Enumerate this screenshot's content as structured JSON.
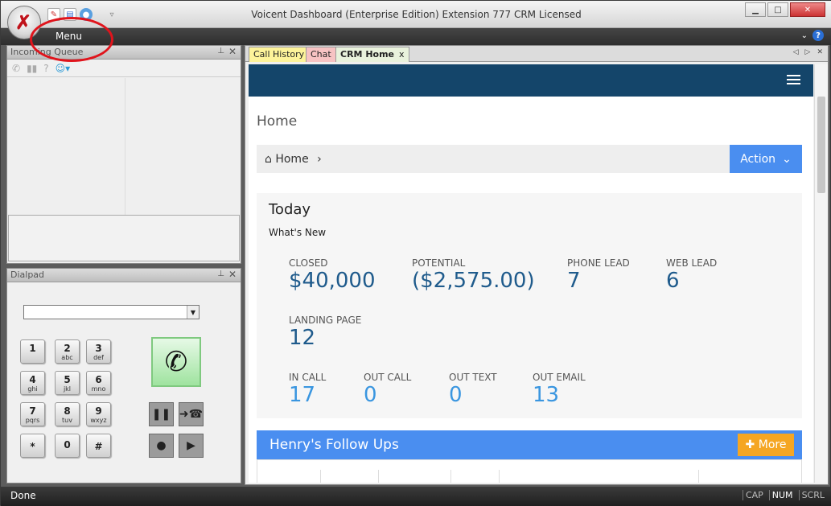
{
  "window": {
    "title": "Voicent Dashboard (Enterprise Edition) Extension 777 CRM Licensed",
    "menu_label": "Menu",
    "buttons": {
      "minimize": "▁",
      "maximize": "□",
      "close": "✕"
    }
  },
  "incoming_queue": {
    "title": "Incoming Queue"
  },
  "dialpad": {
    "title": "Dialpad",
    "keys": [
      {
        "num": "1",
        "letters": ""
      },
      {
        "num": "2",
        "letters": "abc"
      },
      {
        "num": "3",
        "letters": "def"
      },
      {
        "num": "4",
        "letters": "ghi"
      },
      {
        "num": "5",
        "letters": "jkl"
      },
      {
        "num": "6",
        "letters": "mno"
      },
      {
        "num": "7",
        "letters": "pqrs"
      },
      {
        "num": "8",
        "letters": "tuv"
      },
      {
        "num": "9",
        "letters": "wxyz"
      },
      {
        "num": "*",
        "letters": ""
      },
      {
        "num": "0",
        "letters": ""
      },
      {
        "num": "#",
        "letters": ""
      }
    ]
  },
  "tabs": [
    {
      "label": "Call History"
    },
    {
      "label": "Chat"
    },
    {
      "label": "CRM Home",
      "close": "x"
    }
  ],
  "crm": {
    "page_title": "Home",
    "breadcrumb": "Home",
    "action_label": "Action",
    "today_title": "Today",
    "whats_new": "What's New",
    "stats": [
      {
        "label": "CLOSED",
        "value": "$40,000"
      },
      {
        "label": "POTENTIAL",
        "value": "($2,575.00)"
      },
      {
        "label": "PHONE LEAD",
        "value": "7"
      },
      {
        "label": "WEB LEAD",
        "value": "6"
      },
      {
        "label": "LANDING PAGE",
        "value": "12"
      },
      {
        "label": "IN CALL",
        "value": "17"
      },
      {
        "label": "OUT CALL",
        "value": "0"
      },
      {
        "label": "OUT TEXT",
        "value": "0"
      },
      {
        "label": "OUT EMAIL",
        "value": "13"
      }
    ],
    "followups_title": "Henry's Follow Ups",
    "more_label": "More"
  },
  "status": {
    "text": "Done",
    "keys": [
      "CAP",
      "NUM",
      "SCRL"
    ]
  },
  "colors": {
    "header": "#14456a",
    "accent": "#4a8ef0",
    "more": "#f5a623",
    "value": "#1f5b8c",
    "value_alt": "#3a96e0"
  }
}
